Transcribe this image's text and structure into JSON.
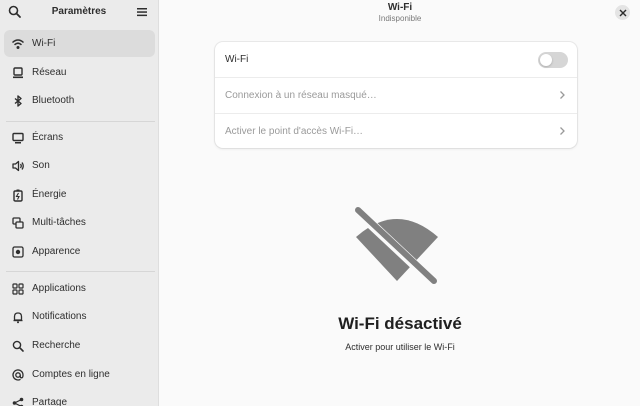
{
  "sidebar": {
    "title": "Paramètres",
    "items": [
      {
        "label": "Wi-Fi"
      },
      {
        "label": "Réseau"
      },
      {
        "label": "Bluetooth"
      },
      {
        "label": "Écrans"
      },
      {
        "label": "Son"
      },
      {
        "label": "Énergie"
      },
      {
        "label": "Multi-tâches"
      },
      {
        "label": "Apparence"
      },
      {
        "label": "Applications"
      },
      {
        "label": "Notifications"
      },
      {
        "label": "Recherche"
      },
      {
        "label": "Comptes en ligne"
      },
      {
        "label": "Partage"
      }
    ]
  },
  "header": {
    "title": "Wi-Fi",
    "subtitle": "Indisponible"
  },
  "card": {
    "wifi_label": "Wi-Fi",
    "wifi_enabled": false,
    "hidden_network_label": "Connexion à un réseau masqué…",
    "hotspot_label": "Activer le point d'accès Wi-Fi…"
  },
  "status": {
    "title": "Wi-Fi désactivé",
    "description": "Activer pour utiliser le Wi-Fi"
  },
  "colors": {
    "sidebar_bg": "#ebebeb",
    "active_item_bg": "#dcdcdc",
    "icon_gray": "#808080"
  }
}
